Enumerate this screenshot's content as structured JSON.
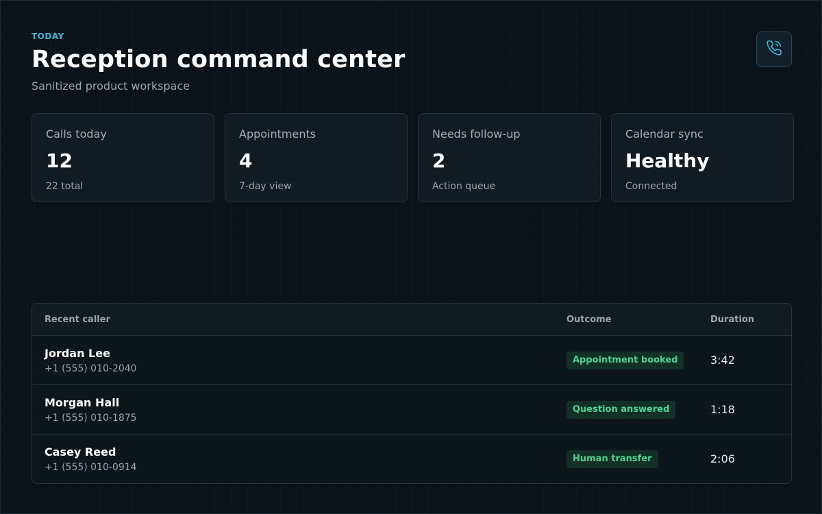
{
  "header": {
    "eyebrow": "TODAY",
    "title": "Reception command center",
    "subtitle": "Sanitized product workspace",
    "action_icon": "phone-call-icon"
  },
  "stats": [
    {
      "label": "Calls today",
      "value": "12",
      "sub": "22 total"
    },
    {
      "label": "Appointments",
      "value": "4",
      "sub": "7-day view"
    },
    {
      "label": "Needs follow-up",
      "value": "2",
      "sub": "Action queue"
    },
    {
      "label": "Calendar sync",
      "value": "Healthy",
      "sub": "Connected"
    }
  ],
  "table": {
    "columns": {
      "caller": "Recent caller",
      "outcome": "Outcome",
      "duration": "Duration"
    },
    "rows": [
      {
        "name": "Jordan Lee",
        "phone": "+1 (555) 010-2040",
        "outcome": "Appointment booked",
        "duration": "3:42"
      },
      {
        "name": "Morgan Hall",
        "phone": "+1 (555) 010-1875",
        "outcome": "Question answered",
        "duration": "1:18"
      },
      {
        "name": "Casey Reed",
        "phone": "+1 (555) 010-0914",
        "outcome": "Human transfer",
        "duration": "2:06"
      }
    ]
  },
  "colors": {
    "accent": "#3fb6dd",
    "background": "#0c1318",
    "badge_text": "#4fd392",
    "badge_bg": "#123026"
  }
}
